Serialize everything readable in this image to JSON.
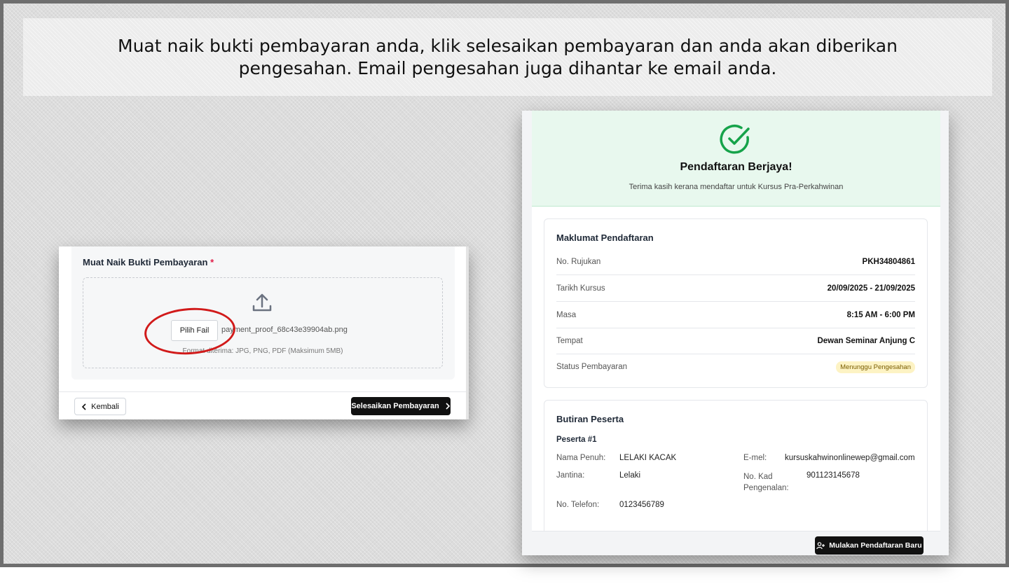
{
  "banner": {
    "text": "Muat naik bukti pembayaran anda, klik selesaikan pembayaran dan anda akan diberikan pengesahan. Email pengesahan juga dihantar ke email anda."
  },
  "upload": {
    "title": "Muat Naik Bukti Pembayaran",
    "required_mark": "*",
    "choose_file_label": "Pilih Fail",
    "file_name": "payment_proof_68c43e39904ab.png",
    "formats_note": "Format diterima: JPG, PNG, PDF (Maksimum 5MB)",
    "back_label": "Kembali",
    "finish_label": "Selesaikan Pembayaran"
  },
  "success": {
    "title": "Pendaftaran Berjaya!",
    "subtitle": "Terima kasih kerana mendaftar untuk Kursus Pra-Perkahwinan",
    "info_title": "Maklumat Pendaftaran",
    "info_rows": [
      {
        "label": "No. Rujukan",
        "value": "PKH34804861"
      },
      {
        "label": "Tarikh Kursus",
        "value": "20/09/2025 - 21/09/2025"
      },
      {
        "label": "Masa",
        "value": "8:15 AM - 6:00 PM"
      },
      {
        "label": "Tempat",
        "value": "Dewan Seminar Anjung C"
      },
      {
        "label": "Status Pembayaran",
        "value": "Menunggu Pengesahan"
      }
    ],
    "participant_title": "Butiran Peserta",
    "participant_num": "Peserta #1",
    "participant": {
      "name_label": "Nama Penuh:",
      "name": "LELAKI KACAK",
      "email_label": "E-mel:",
      "email": "kursuskahwinonlinewep@gmail.com",
      "gender_label": "Jantina:",
      "gender": "Lelaki",
      "ic_label": "No. Kad Pengenalan:",
      "ic": "901123145678",
      "phone_label": "No. Telefon:",
      "phone": "0123456789"
    },
    "new_registration_label": "Mulakan Pendaftaran Baru"
  },
  "colors": {
    "success_green": "#16a34a",
    "dark_button": "#111111",
    "annotation_red": "#d11a1a",
    "status_badge_bg": "#fdf3c4"
  }
}
